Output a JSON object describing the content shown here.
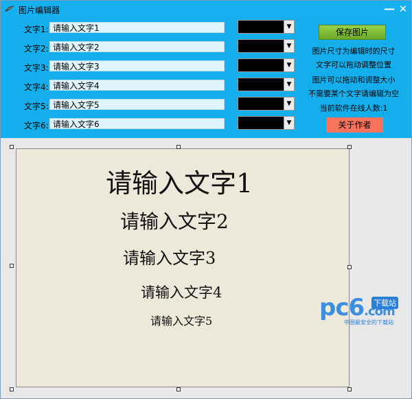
{
  "window": {
    "title": "图片编辑器",
    "minimize_glyph": "—",
    "close_glyph": "✕"
  },
  "rows": [
    {
      "label": "文字1:",
      "value": "请输入文字1"
    },
    {
      "label": "文字2:",
      "value": "请输入文字2"
    },
    {
      "label": "文字3:",
      "value": "请输入文字3"
    },
    {
      "label": "文字4:",
      "value": "请输入文字4"
    },
    {
      "label": "文字5:",
      "value": "请输入文字5"
    },
    {
      "label": "文字6:",
      "value": "请输入文字6"
    }
  ],
  "color_selects": {
    "selected_color": "#000000",
    "arrow_glyph": "▼"
  },
  "buttons": {
    "save": "保存图片",
    "about": "关于作者"
  },
  "info": [
    "图片尺寸为编辑时的尺寸",
    "文字可以拖动调整位置",
    "图片可以拖动和调整大小",
    "不需要某个文字请编辑为空",
    "当前软件在线人数:1"
  ],
  "canvas": {
    "background": "#ece8da",
    "texts": [
      "请输入文字1",
      "请输入文字2",
      "请输入文字3",
      "请输入文字4",
      "请输入文字5"
    ]
  },
  "watermark": {
    "logo": "pc6",
    "logo_suffix": ".com",
    "badge": "下载站",
    "tagline": "中国最安全的下载站"
  },
  "colors": {
    "titlebar": "#17b0ef",
    "panel": "#15aeec",
    "save_button": "#7ab836",
    "about_button": "#f7735c"
  },
  "icons": {
    "app": "app-icon",
    "dropdown": "chevron-down-icon"
  }
}
